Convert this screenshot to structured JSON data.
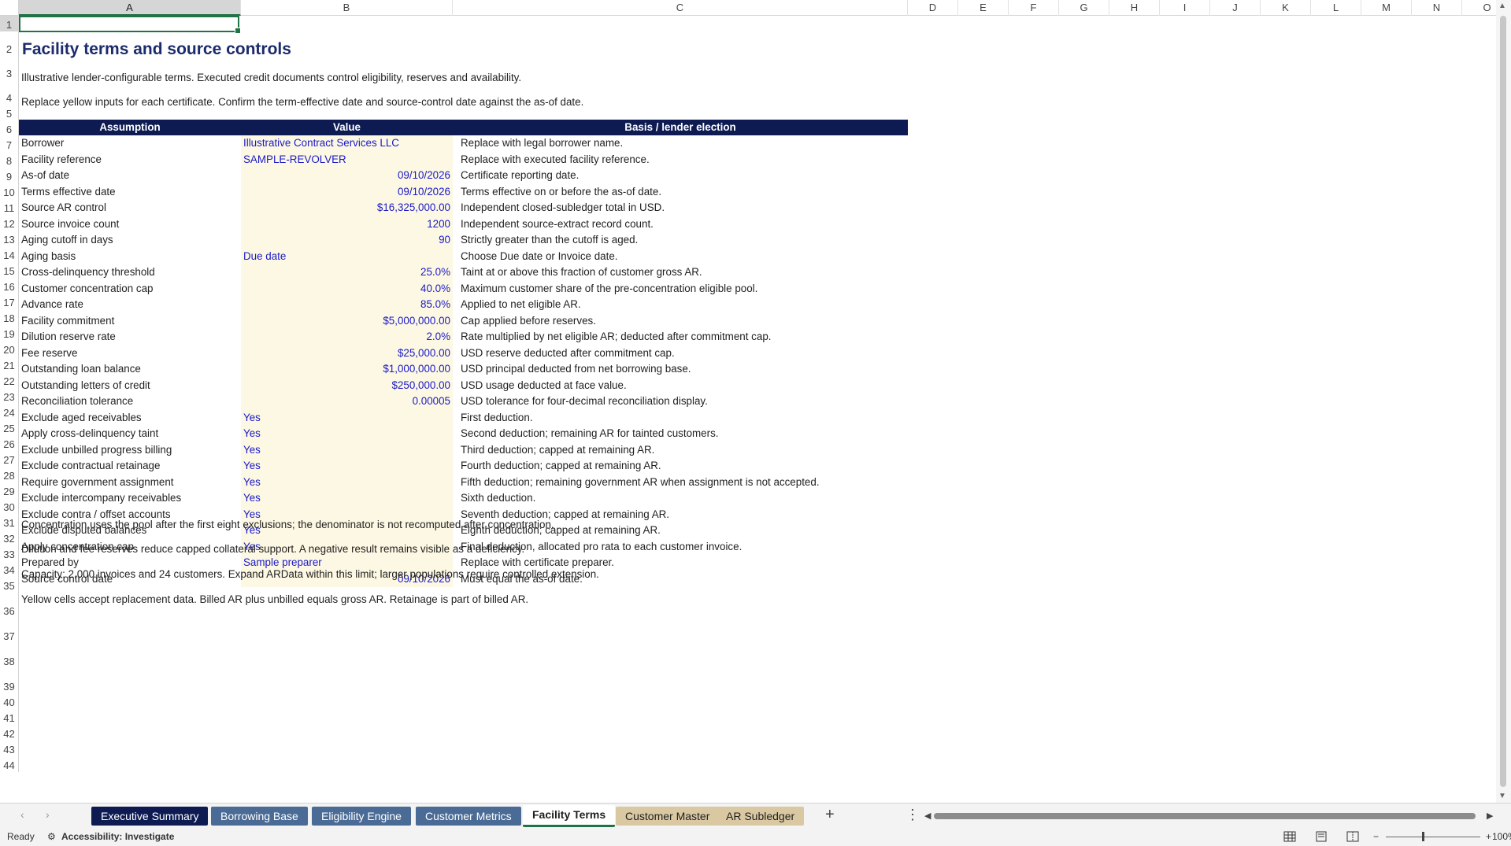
{
  "columns": [
    "A",
    "B",
    "C",
    "D",
    "E",
    "F",
    "G",
    "H",
    "I",
    "J",
    "K",
    "L",
    "M",
    "N",
    "O"
  ],
  "rows": [
    "1",
    "2",
    "3",
    "4",
    "5",
    "6",
    "7",
    "8",
    "9",
    "10",
    "11",
    "12",
    "13",
    "14",
    "15",
    "16",
    "17",
    "18",
    "19",
    "20",
    "21",
    "22",
    "23",
    "24",
    "25",
    "26",
    "27",
    "28",
    "29",
    "30",
    "31",
    "32",
    "33",
    "34",
    "35",
    "36",
    "37",
    "38",
    "39",
    "40",
    "41",
    "42",
    "43",
    "44"
  ],
  "sheet": {
    "title": "Facility terms and source controls",
    "note1": "Illustrative lender-configurable terms. Executed credit documents control eligibility, reserves and availability.",
    "note2": "Replace yellow inputs for each certificate. Confirm the term-effective date and source-control date against the as-of date.",
    "headers": {
      "assumption": "Assumption",
      "value": "Value",
      "basis": "Basis / lender election"
    },
    "table": [
      {
        "a": "Borrower",
        "b": "Illustrative Contract Services LLC",
        "c": "Replace with legal borrower name.",
        "num": false
      },
      {
        "a": "Facility reference",
        "b": "SAMPLE-REVOLVER",
        "c": "Replace with executed facility reference.",
        "num": false
      },
      {
        "a": "As-of date",
        "b": "09/10/2026",
        "c": "Certificate reporting date.",
        "num": true
      },
      {
        "a": "Terms effective date",
        "b": "09/10/2026",
        "c": "Terms effective on or before the as-of date.",
        "num": true
      },
      {
        "a": "Source AR control",
        "b": "$16,325,000.00",
        "c": "Independent closed-subledger total in USD.",
        "num": true
      },
      {
        "a": "Source invoice count",
        "b": "1200",
        "c": "Independent source-extract record count.",
        "num": true
      },
      {
        "a": "Aging cutoff in days",
        "b": "90",
        "c": "Strictly greater than the cutoff is aged.",
        "num": true
      },
      {
        "a": "Aging basis",
        "b": "Due date",
        "c": "Choose Due date or Invoice date.",
        "num": false
      },
      {
        "a": "Cross-delinquency threshold",
        "b": "25.0%",
        "c": "Taint at or above this fraction of customer gross AR.",
        "num": true
      },
      {
        "a": "Customer concentration cap",
        "b": "40.0%",
        "c": "Maximum customer share of the pre-concentration eligible pool.",
        "num": true
      },
      {
        "a": "Advance rate",
        "b": "85.0%",
        "c": "Applied to net eligible AR.",
        "num": true
      },
      {
        "a": "Facility commitment",
        "b": "$5,000,000.00",
        "c": "Cap applied before reserves.",
        "num": true
      },
      {
        "a": "Dilution reserve rate",
        "b": "2.0%",
        "c": "Rate multiplied by net eligible AR; deducted after commitment cap.",
        "num": true
      },
      {
        "a": "Fee reserve",
        "b": "$25,000.00",
        "c": "USD reserve deducted after commitment cap.",
        "num": true
      },
      {
        "a": "Outstanding loan balance",
        "b": "$1,000,000.00",
        "c": "USD principal deducted from net borrowing base.",
        "num": true
      },
      {
        "a": "Outstanding letters of credit",
        "b": "$250,000.00",
        "c": "USD usage deducted at face value.",
        "num": true
      },
      {
        "a": "Reconciliation tolerance",
        "b": "0.00005",
        "c": "USD tolerance for four-decimal reconciliation display.",
        "num": true
      },
      {
        "a": "Exclude aged receivables",
        "b": "Yes",
        "c": "First deduction.",
        "num": false
      },
      {
        "a": "Apply cross-delinquency taint",
        "b": "Yes",
        "c": "Second deduction; remaining AR for tainted customers.",
        "num": false
      },
      {
        "a": "Exclude unbilled progress billing",
        "b": "Yes",
        "c": "Third deduction; capped at remaining AR.",
        "num": false
      },
      {
        "a": "Exclude contractual retainage",
        "b": "Yes",
        "c": "Fourth deduction; capped at remaining AR.",
        "num": false
      },
      {
        "a": "Require government assignment",
        "b": "Yes",
        "c": "Fifth deduction; remaining government AR when assignment is not accepted.",
        "num": false
      },
      {
        "a": "Exclude intercompany receivables",
        "b": "Yes",
        "c": "Sixth deduction.",
        "num": false
      },
      {
        "a": "Exclude contra / offset accounts",
        "b": "Yes",
        "c": "Seventh deduction; capped at remaining AR.",
        "num": false
      },
      {
        "a": "Exclude disputed balances",
        "b": "Yes",
        "c": "Eighth deduction; capped at remaining AR.",
        "num": false
      },
      {
        "a": "Apply concentration cap",
        "b": "Yes",
        "c": "Final deduction, allocated pro rata to each customer invoice.",
        "num": false
      },
      {
        "a": "Prepared by",
        "b": "Sample preparer",
        "c": "Replace with certificate preparer.",
        "num": false
      },
      {
        "a": "Source control date",
        "b": "09/10/2026",
        "c": "Must equal the as-of date.",
        "num": true
      }
    ],
    "notes_bottom": [
      "Concentration uses the pool after the first eight exclusions; the denominator is not recomputed after concentration.",
      "Dilution and fee reserves reduce capped collateral support. A negative result remains visible as a deficiency.",
      "Capacity: 2,000 invoices and 24 customers. Expand ARData within this limit; larger populations require controlled extension.",
      "Yellow cells accept replacement data. Billed AR plus unbilled equals gross AR. Retainage is part of billed AR."
    ]
  },
  "tabs": [
    {
      "label": "Executive Summary",
      "style": "dark"
    },
    {
      "label": "Borrowing Base",
      "style": "steel"
    },
    {
      "label": "Eligibility Engine",
      "style": "steel"
    },
    {
      "label": "Customer Metrics",
      "style": "steel"
    },
    {
      "label": "Facility Terms",
      "style": "active"
    },
    {
      "label": "Customer Master",
      "style": "tan"
    },
    {
      "label": "AR Subledger",
      "style": "tan"
    }
  ],
  "status": {
    "ready": "Ready",
    "accessibility": "Accessibility: Investigate",
    "zoom": "100%"
  },
  "icons": {
    "add_sheet": "+",
    "more": "⋮",
    "prev": "‹",
    "next": "›"
  }
}
